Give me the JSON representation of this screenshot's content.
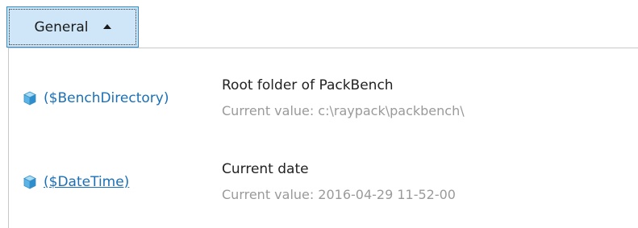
{
  "group": {
    "title": "General",
    "collapse_icon": "caret-up-icon"
  },
  "variables": [
    {
      "name": "($BenchDirectory)",
      "description": "Root folder of PackBench",
      "value_label": "Current value:",
      "value": "c:\\raypack\\packbench\\",
      "icon": "cube-icon",
      "underlined": false
    },
    {
      "name": "($DateTime)",
      "description": "Current date",
      "value_label": "Current value:",
      "value": "2016-04-29 11-52-00",
      "icon": "cube-icon",
      "underlined": true
    }
  ],
  "colors": {
    "header_bg": "#cfe6f8",
    "header_border": "#2f8bd0",
    "link": "#1a70b8",
    "muted_text": "#9a9a9a"
  }
}
